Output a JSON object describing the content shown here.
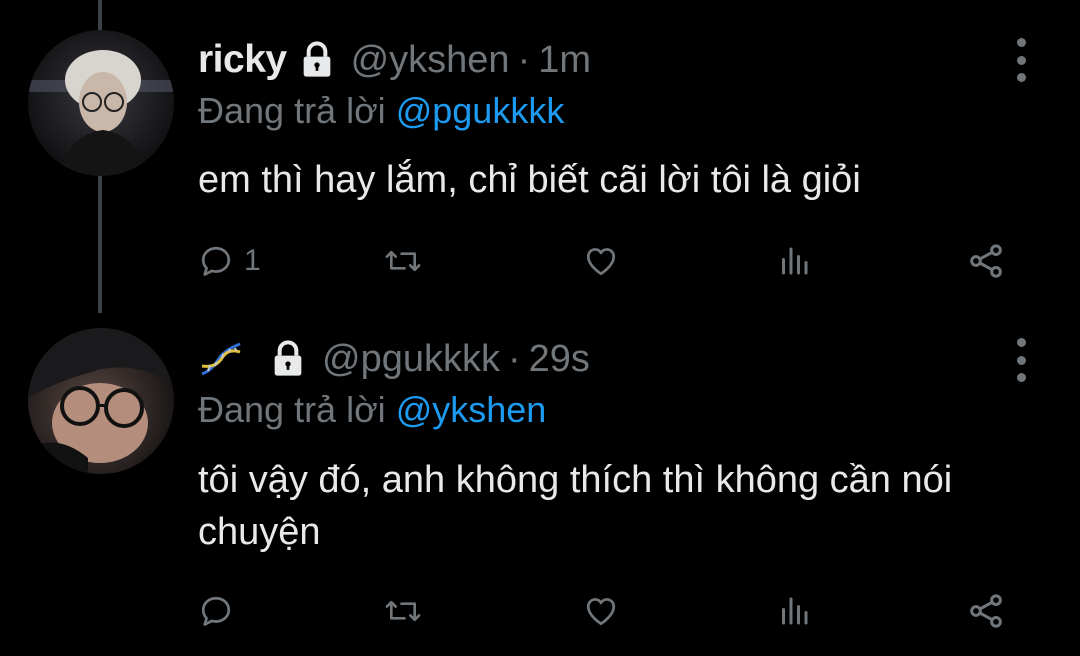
{
  "tweets": [
    {
      "name": "ricky",
      "handle": "@ykshen",
      "separator": "·",
      "time": "1m",
      "reply_prefix": "Đang trả lời",
      "reply_to": "@pgukkkk",
      "text": "em thì hay lắm, chỉ biết cãi lời tôi là giỏi",
      "reply_count": "1",
      "icons": [
        "lock-icon",
        "reply-icon",
        "retweet-icon",
        "like-icon",
        "views-icon",
        "share-icon",
        "more-icon"
      ]
    },
    {
      "name": "",
      "handle": "@pgukkkk",
      "separator": "·",
      "time": "29s",
      "reply_prefix": "Đang trả lời",
      "reply_to": "@ykshen",
      "text": "tôi vậy đó, anh không thích thì không cần nói chuyện",
      "reply_count": "",
      "icons": [
        "dna-icon",
        "lock-icon",
        "reply-icon",
        "retweet-icon",
        "like-icon",
        "views-icon",
        "share-icon",
        "more-icon"
      ]
    }
  ],
  "colors": {
    "background": "#000000",
    "text": "#e7e9ea",
    "muted": "#71767b",
    "mention": "#1d9bf0",
    "thread_line": "#3d4248"
  }
}
